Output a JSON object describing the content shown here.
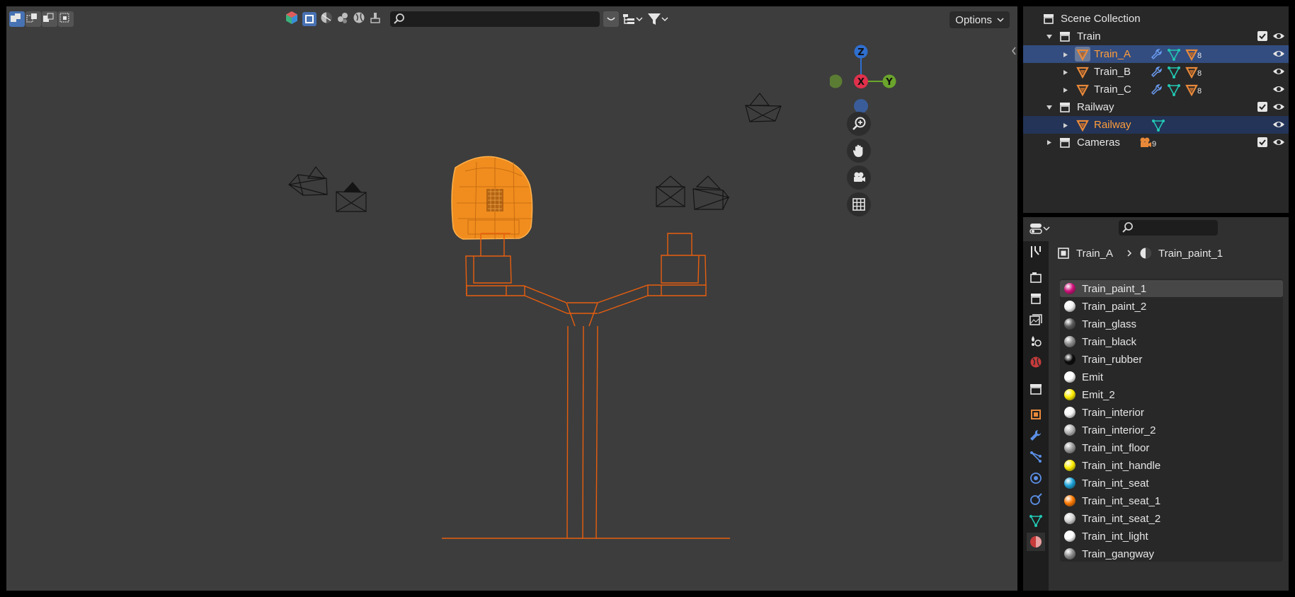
{
  "viewport": {
    "options_label": "Options",
    "gizmo": {
      "z": "Z",
      "x": "X",
      "y": "Y"
    }
  },
  "outliner": {
    "rows": [
      {
        "label": "Scene Collection",
        "icon": "collection-icon"
      },
      {
        "label": "Train",
        "icon": "collection-icon"
      },
      {
        "label": "Train_A",
        "icon": "mesh-object-icon",
        "mesh_count": "8"
      },
      {
        "label": "Train_B",
        "icon": "mesh-object-icon",
        "mesh_count": "8"
      },
      {
        "label": "Train_C",
        "icon": "mesh-object-icon",
        "mesh_count": "8"
      },
      {
        "label": "Railway",
        "icon": "collection-icon"
      },
      {
        "label": "Railway",
        "icon": "mesh-object-icon"
      },
      {
        "label": "Cameras",
        "icon": "collection-icon",
        "camera_count": "9"
      }
    ]
  },
  "properties": {
    "breadcrumb": {
      "object": "Train_A",
      "material": "Train_paint_1"
    },
    "materials": [
      {
        "name": "Train_paint_1",
        "color": "#d0107a"
      },
      {
        "name": "Train_paint_2",
        "color": "#f2f2f2"
      },
      {
        "name": "Train_glass",
        "color": "#5a5a5a"
      },
      {
        "name": "Train_black",
        "color": "#8c8c8c"
      },
      {
        "name": "Train_rubber",
        "color": "#0a0a0a"
      },
      {
        "name": "Emit",
        "color": "#ffffff"
      },
      {
        "name": "Emit_2",
        "color": "#ffee00"
      },
      {
        "name": "Train_interior",
        "color": "#f5f5f5"
      },
      {
        "name": "Train_interior_2",
        "color": "#b5b5b5"
      },
      {
        "name": "Train_int_floor",
        "color": "#9a9a9a"
      },
      {
        "name": "Train_int_handle",
        "color": "#ffee00"
      },
      {
        "name": "Train_int_seat",
        "color": "#1ba3d9"
      },
      {
        "name": "Train_int_seat_1",
        "color": "#ff7a00"
      },
      {
        "name": "Train_int_seat_2",
        "color": "#d5d5d5"
      },
      {
        "name": "Train_int_light",
        "color": "#ffffff"
      },
      {
        "name": "Train_gangway",
        "color": "#8a8a8a"
      }
    ]
  }
}
